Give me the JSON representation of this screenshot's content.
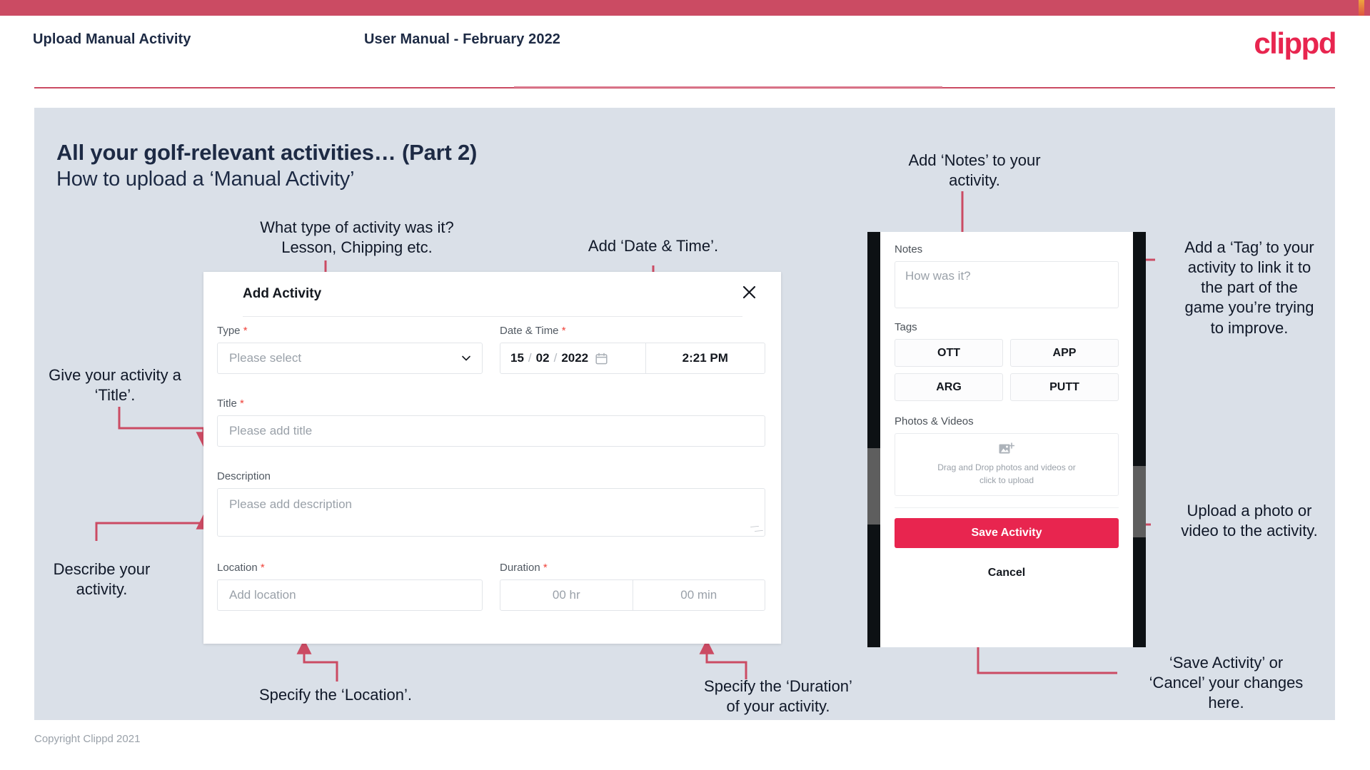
{
  "header": {
    "left_title": "Upload Manual Activity",
    "center_title": "User Manual - February 2022",
    "logo": "clippd"
  },
  "slide": {
    "title_main": "All your golf-relevant activities… (Part 2)",
    "title_sub": "How to upload a ‘Manual Activity’"
  },
  "annotations": {
    "type_note_line1": "What type of activity was it?",
    "type_note_line2": "Lesson, Chipping etc.",
    "datetime_note": "Add ‘Date & Time’.",
    "title_note_line1": "Give your activity a",
    "title_note_line2": "‘Title’.",
    "description_note_line1": "Describe your",
    "description_note_line2": "activity.",
    "location_note": "Specify the ‘Location’.",
    "duration_note_line1": "Specify the ‘Duration’",
    "duration_note_line2": "of your activity.",
    "notes_note_line1": "Add ‘Notes’ to your",
    "notes_note_line2": "activity.",
    "tag_note_line1": "Add a ‘Tag’ to your",
    "tag_note_line2": "activity to link it to",
    "tag_note_line3": "the part of the",
    "tag_note_line4": "game you’re trying",
    "tag_note_line5": "to improve.",
    "upload_note_line1": "Upload a photo or",
    "upload_note_line2": "video to the activity.",
    "save_note_line1": "‘Save Activity’ or",
    "save_note_line2": "‘Cancel’ your changes",
    "save_note_line3": "here."
  },
  "dialog": {
    "title": "Add Activity",
    "close_icon": "close-icon",
    "fields": {
      "type_label": "Type",
      "type_required": "*",
      "type_placeholder": "Please select",
      "datetime_label": "Date & Time",
      "datetime_required": "*",
      "date_day": "15",
      "date_month": "02",
      "date_year": "2022",
      "date_sep": "/",
      "time_value": "2:21 PM",
      "title_label": "Title",
      "title_required": "*",
      "title_placeholder": "Please add title",
      "description_label": "Description",
      "description_placeholder": "Please add description",
      "location_label": "Location",
      "location_required": "*",
      "location_placeholder": "Add location",
      "duration_label": "Duration",
      "duration_required": "*",
      "duration_hours": "00 hr",
      "duration_minutes": "00 min"
    }
  },
  "phone": {
    "notes_label": "Notes",
    "notes_placeholder": "How was it?",
    "tags_label": "Tags",
    "tags": [
      "OTT",
      "APP",
      "ARG",
      "PUTT"
    ],
    "photos_label": "Photos & Videos",
    "drop_line1": "Drag and Drop photos and videos or",
    "drop_line2": "click to upload",
    "save_label": "Save Activity",
    "cancel_label": "Cancel"
  },
  "footer": {
    "copyright": "Copyright Clippd 2021"
  },
  "colors": {
    "brand_pink": "#e8254f",
    "top_bar": "#cb4b63",
    "arrow": "#cb4b63",
    "slide_bg": "#dae0e8",
    "text_dark": "#1d2a44"
  }
}
